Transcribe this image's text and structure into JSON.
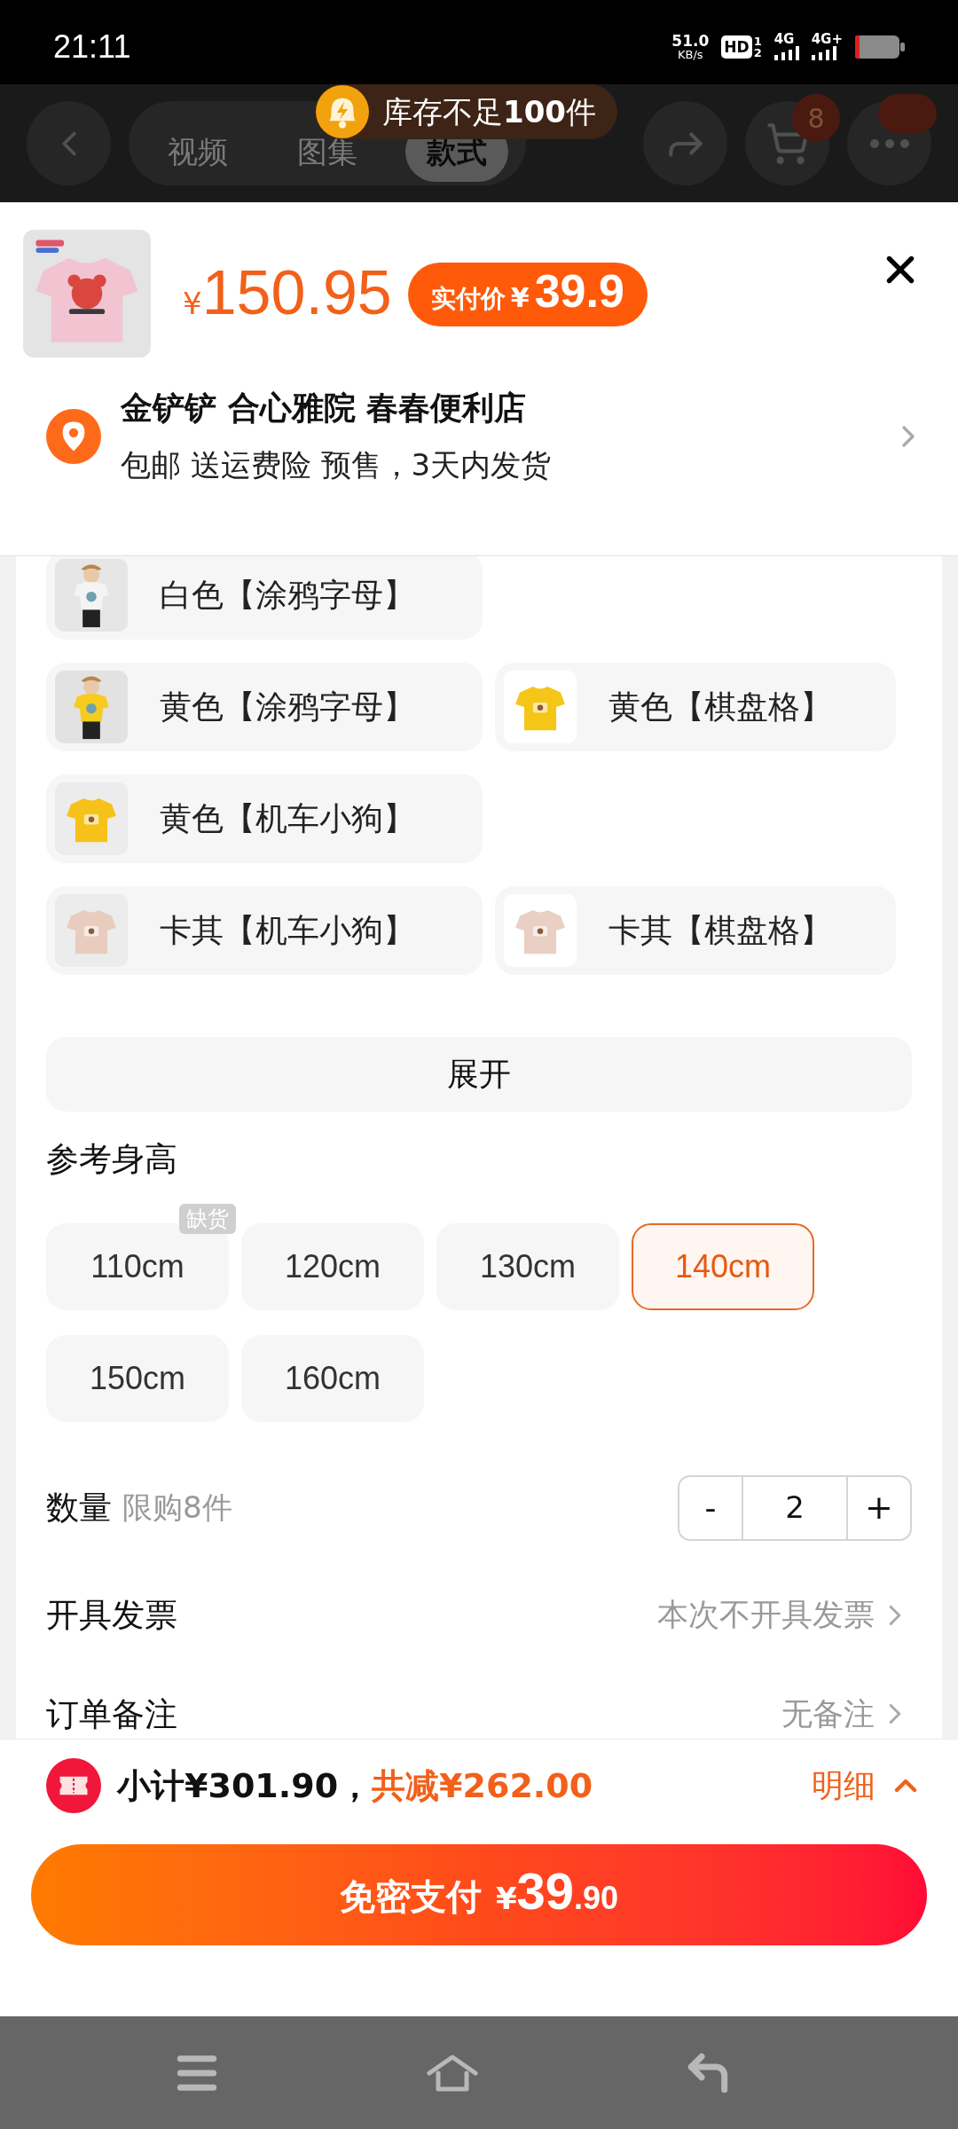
{
  "status_bar": {
    "time": "21:11",
    "speed": "51.0",
    "speed_unit": "KB/s",
    "hd": "HD",
    "sims": [
      "1",
      "2"
    ],
    "networks": [
      "4G",
      "4G+"
    ]
  },
  "header": {
    "tabs": [
      {
        "label": "视频",
        "selected": false
      },
      {
        "label": "图集",
        "selected": false
      },
      {
        "label": "款式",
        "selected": true
      }
    ],
    "cart_badge": "8"
  },
  "toast": {
    "text": "库存不足**100**件"
  },
  "product": {
    "price_symbol": "¥",
    "price": "150.95",
    "paid_label": "实付价",
    "paid_symbol": "¥",
    "paid_price": "39.9"
  },
  "address": {
    "name": "金铲铲 合心雅院 春春便利店",
    "info": "包邮 送运费险 预售，3天内发货"
  },
  "variant_rows": [
    [
      {
        "label": "白色【涂鸦字母】",
        "selected": false
      }
    ],
    [
      {
        "label": "黄色【涂鸦字母】",
        "selected": false
      },
      {
        "label": "黄色【棋盘格】",
        "selected": false
      }
    ],
    [
      {
        "label": "黄色【机车小狗】",
        "selected": false
      }
    ],
    [
      {
        "label": "卡其【机车小狗】",
        "selected": false
      },
      {
        "label": "卡其【棋盘格】",
        "selected": false
      }
    ]
  ],
  "expand_button": "展开",
  "size_section": {
    "title": "参考身高",
    "options": [
      {
        "label": "110cm",
        "selected": false,
        "tag": "缺货"
      },
      {
        "label": "120cm",
        "selected": false
      },
      {
        "label": "130cm",
        "selected": false
      },
      {
        "label": "140cm",
        "selected": true
      },
      {
        "label": "150cm",
        "selected": false
      },
      {
        "label": "160cm",
        "selected": false
      }
    ]
  },
  "quantity": {
    "label": "数量",
    "limit": "限购8件",
    "minus": "-",
    "value": "2",
    "plus": "+"
  },
  "invoice": {
    "label": "开具发票",
    "value": "本次不开具发票"
  },
  "remark": {
    "label": "订单备注",
    "value": "无备注"
  },
  "summary": {
    "subtotal": "小计¥301.90，",
    "discount": "共减¥262.00",
    "detail": "明细"
  },
  "pay_button": {
    "label": "免密支付",
    "symbol": "¥",
    "integer": "39",
    "decimal": ".90"
  }
}
